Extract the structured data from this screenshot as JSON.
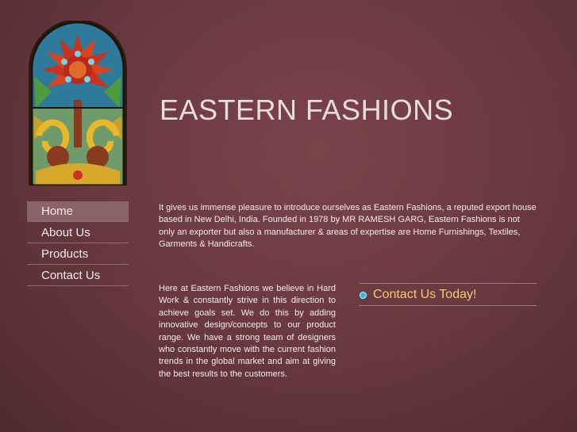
{
  "site": {
    "title": "EASTERN FASHIONS"
  },
  "nav": {
    "items": [
      {
        "label": "Home",
        "active": true
      },
      {
        "label": "About Us"
      },
      {
        "label": "Products"
      },
      {
        "label": "Contact Us"
      }
    ]
  },
  "content": {
    "intro": "It gives us immense pleasure to introduce ourselves as Eastern Fashions, a reputed export house based in New Delhi, India. Founded in 1978 by MR RAMESH GARG,  Eastern Fashions is not only an exporter but also a manufacturer & areas of expertise are Home Furnishings, Textiles, Garments & Handicrafts.",
    "about": "Here at Eastern Fashions we believe in Hard Work & constantly strive in this direction to achieve goals set. We do this by adding innovative design/concepts to our product range. We have a strong team of designers who constantly move with the current fashion trends in the global market and aim at giving the best results to the customers."
  },
  "contact_cta": {
    "label": "Contact Us Today!"
  },
  "colors": {
    "background": "#6a3a3f",
    "title": "#e8dcd6",
    "cta": "#f2c97a",
    "nav_active": "#8a6367",
    "bullet": "#3fb0d8"
  },
  "icons": {
    "logo": "stained-glass-window",
    "cta_bullet": "blue-bullet-icon"
  }
}
